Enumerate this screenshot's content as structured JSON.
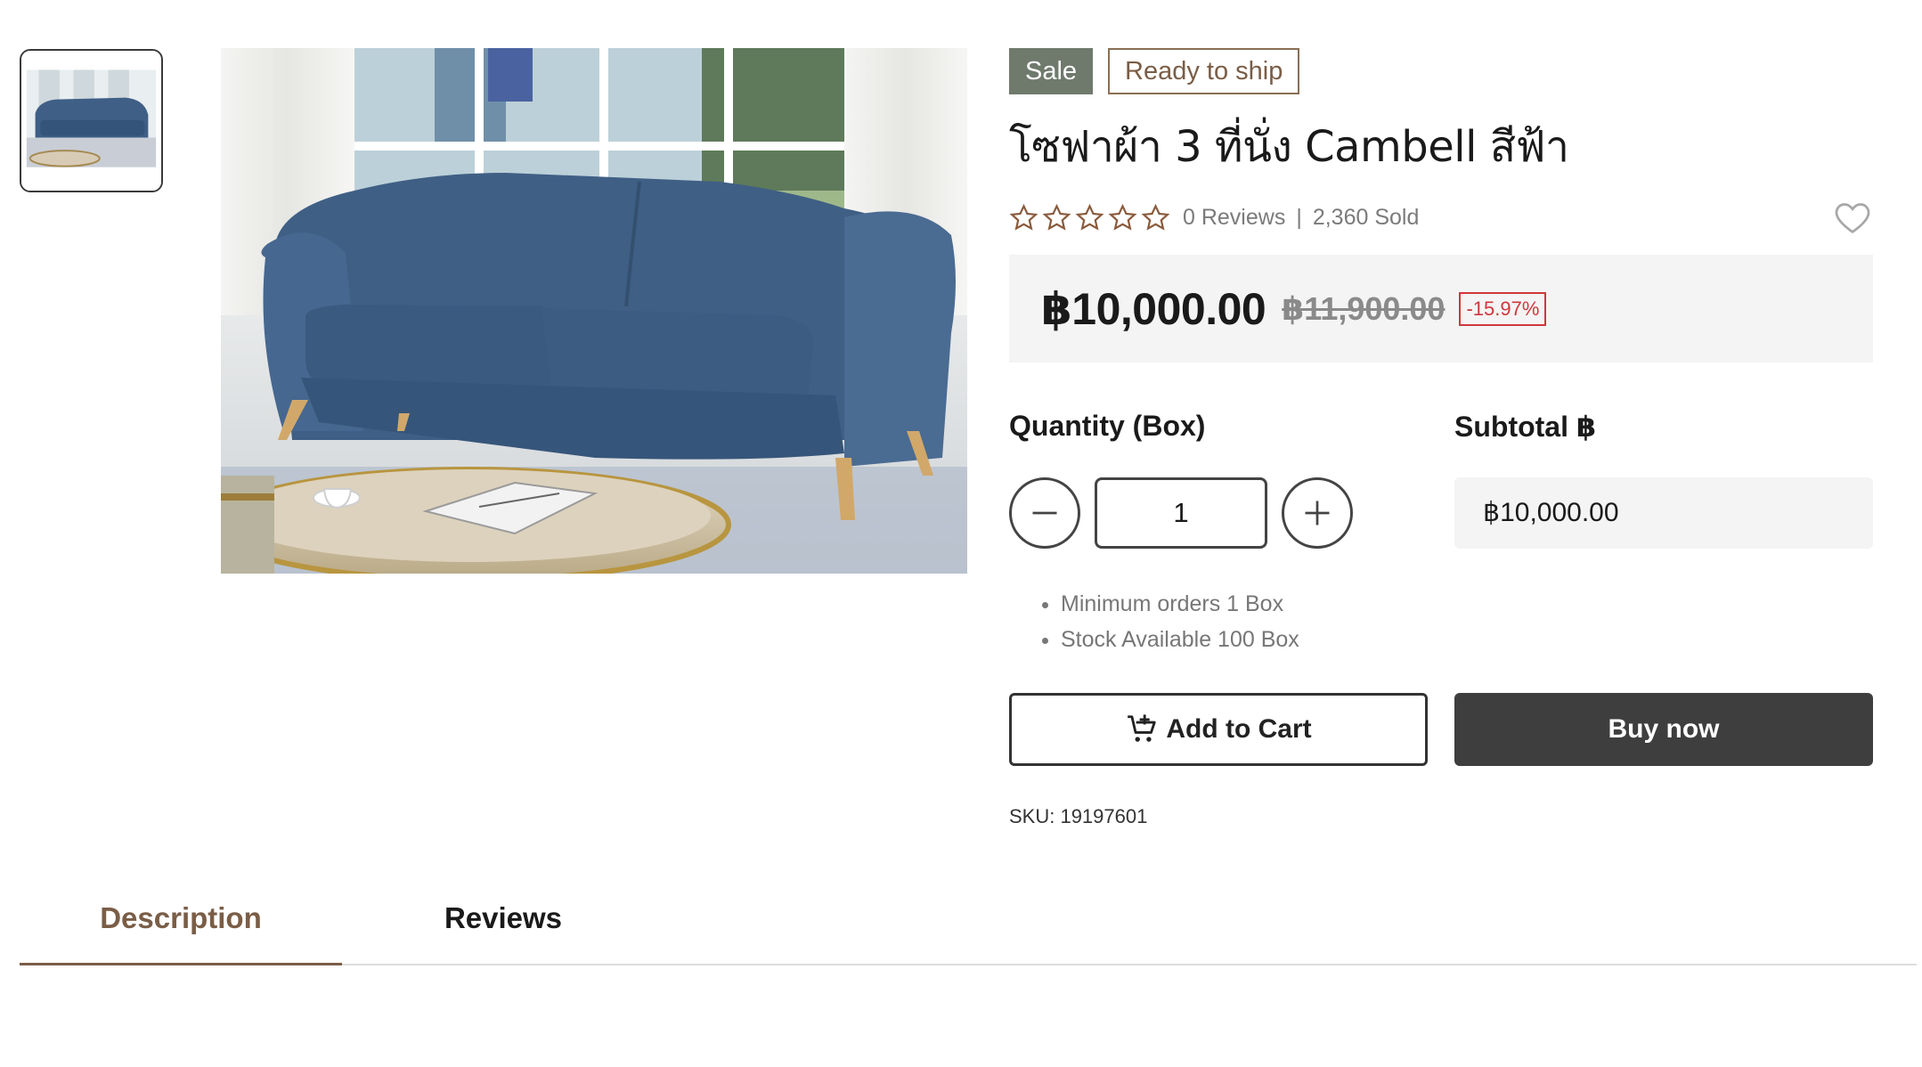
{
  "gallery": {
    "thumbnail_alt": "Sofa thumbnail",
    "main_alt": "Blue fabric 3-seater sofa"
  },
  "badges": {
    "sale": "Sale",
    "ready": "Ready to ship"
  },
  "product": {
    "title": "โซฟาผ้า 3 ที่นั่ง Cambell สีฟ้า",
    "reviews": "0 Reviews",
    "separator": "|",
    "sold": "2,360 Sold",
    "rating": 0,
    "rating_max": 5,
    "price_now": "฿10,000.00",
    "price_old": "฿11,900.00",
    "discount": "-15.97%",
    "sku": "SKU: 19197601"
  },
  "purchase": {
    "quantity_label": "Quantity (Box)",
    "subtotal_label": "Subtotal ฿",
    "quantity_value": "1",
    "subtotal_value": "฿10,000.00",
    "notes": [
      "Minimum orders 1 Box",
      "Stock Available 100 Box"
    ],
    "add_to_cart": "Add to Cart",
    "buy_now": "Buy now"
  },
  "tabs": {
    "description": "Description",
    "reviews": "Reviews"
  },
  "colors": {
    "sale_badge": "#6f7a6d",
    "accent_brown": "#7a5d46",
    "discount_red": "#d0373d",
    "buy_button": "#3e3e3e",
    "star_outline": "#8a5a3c"
  }
}
